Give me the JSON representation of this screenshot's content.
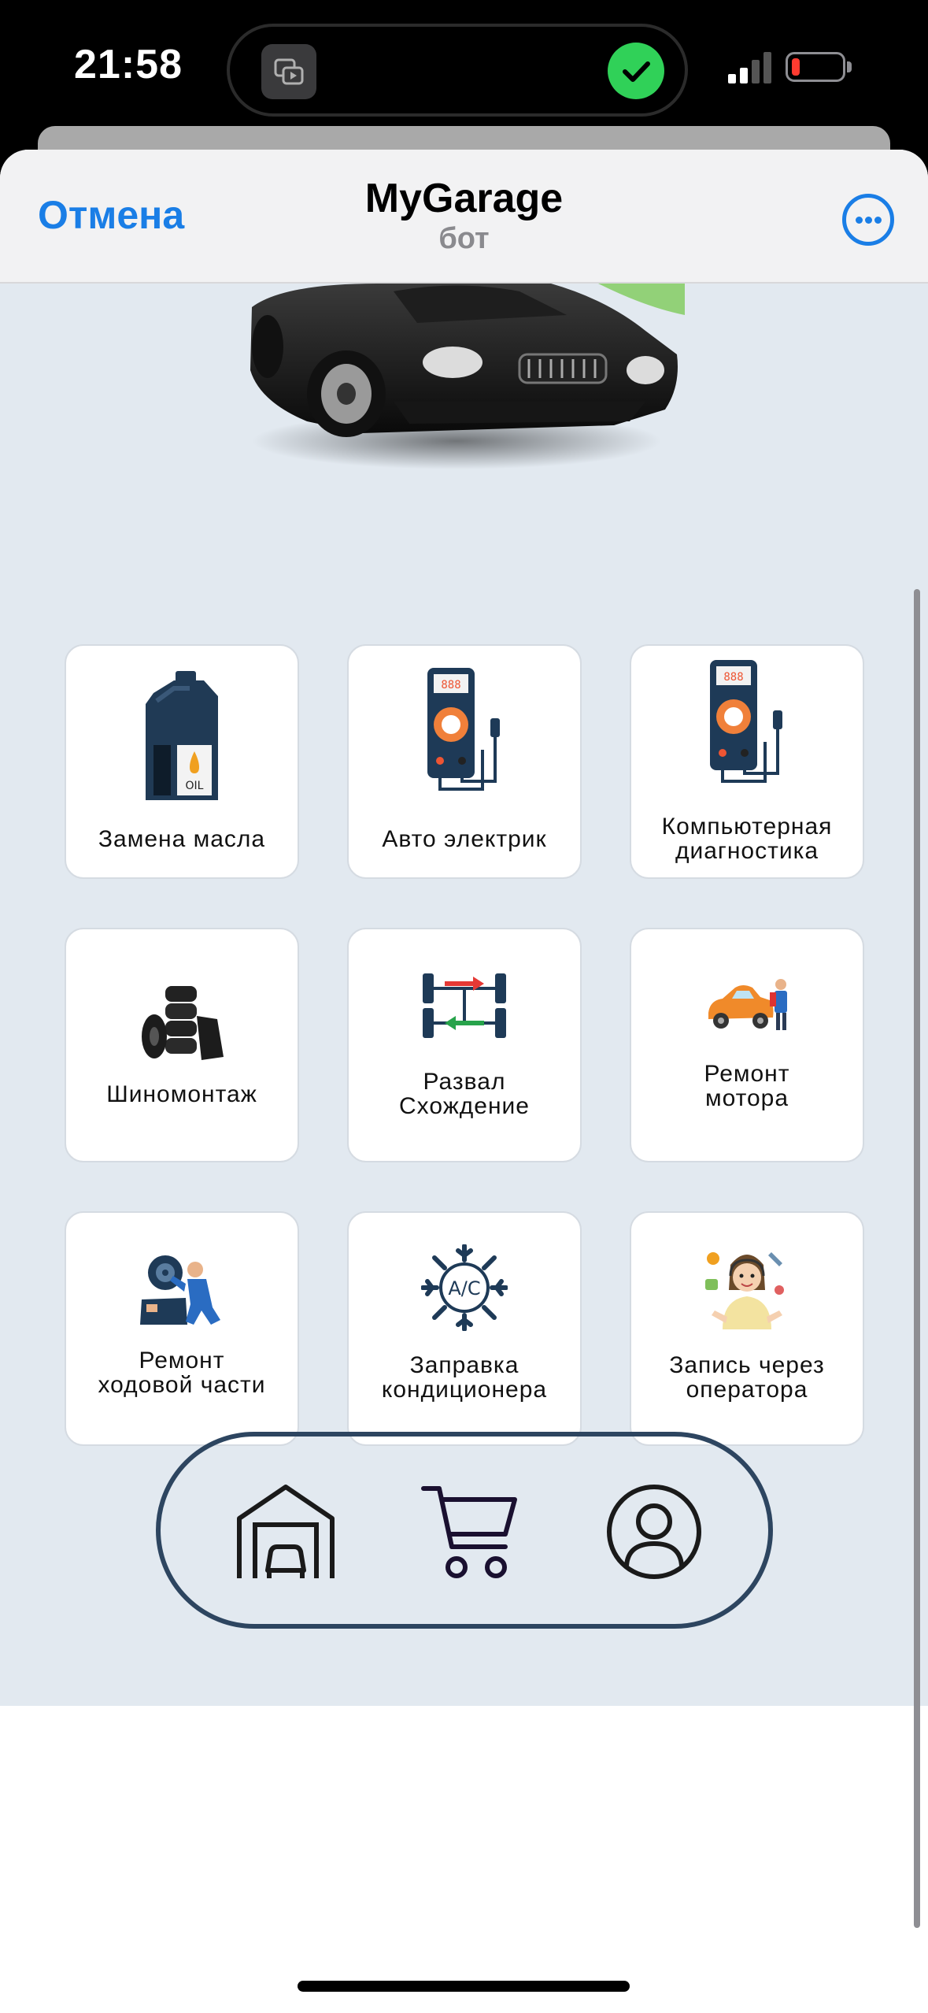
{
  "status_bar": {
    "time": "21:58",
    "icons": [
      "screen-mirroring-icon",
      "checkmark-icon",
      "cellular-signal-icon",
      "battery-low-icon"
    ]
  },
  "header": {
    "cancel_label": "Отмена",
    "title": "MyGarage",
    "subtitle": "бот",
    "more_icon": "ellipsis-circle-icon"
  },
  "services": [
    {
      "label": "Замена масла",
      "icon": "oil-canister-icon"
    },
    {
      "label": "Авто электрик",
      "icon": "multimeter-icon"
    },
    {
      "label": "Компьютерная\nдиагностика",
      "icon": "multimeter-icon"
    },
    {
      "label": "Шиномонтаж",
      "icon": "tire-stack-icon"
    },
    {
      "label": "Развал\nСхождение",
      "icon": "wheel-alignment-icon"
    },
    {
      "label": "Ремонт\nмотора",
      "icon": "engine-repair-car-icon"
    },
    {
      "label": "Ремонт\nходовой части",
      "icon": "mechanic-icon"
    },
    {
      "label": "Заправка\nкондиционера",
      "icon": "ac-snowflake-icon"
    },
    {
      "label": "Запись через\nоператора",
      "icon": "operator-icon"
    }
  ],
  "bottom_nav": {
    "items": [
      "garage-icon",
      "cart-icon",
      "profile-icon"
    ]
  },
  "colors": {
    "link_blue": "#1a7ee6",
    "webview_bg": "#e2e9f0",
    "nav_border": "#2d4560",
    "check_green": "#30d158",
    "battery_red": "#ff3b30"
  }
}
